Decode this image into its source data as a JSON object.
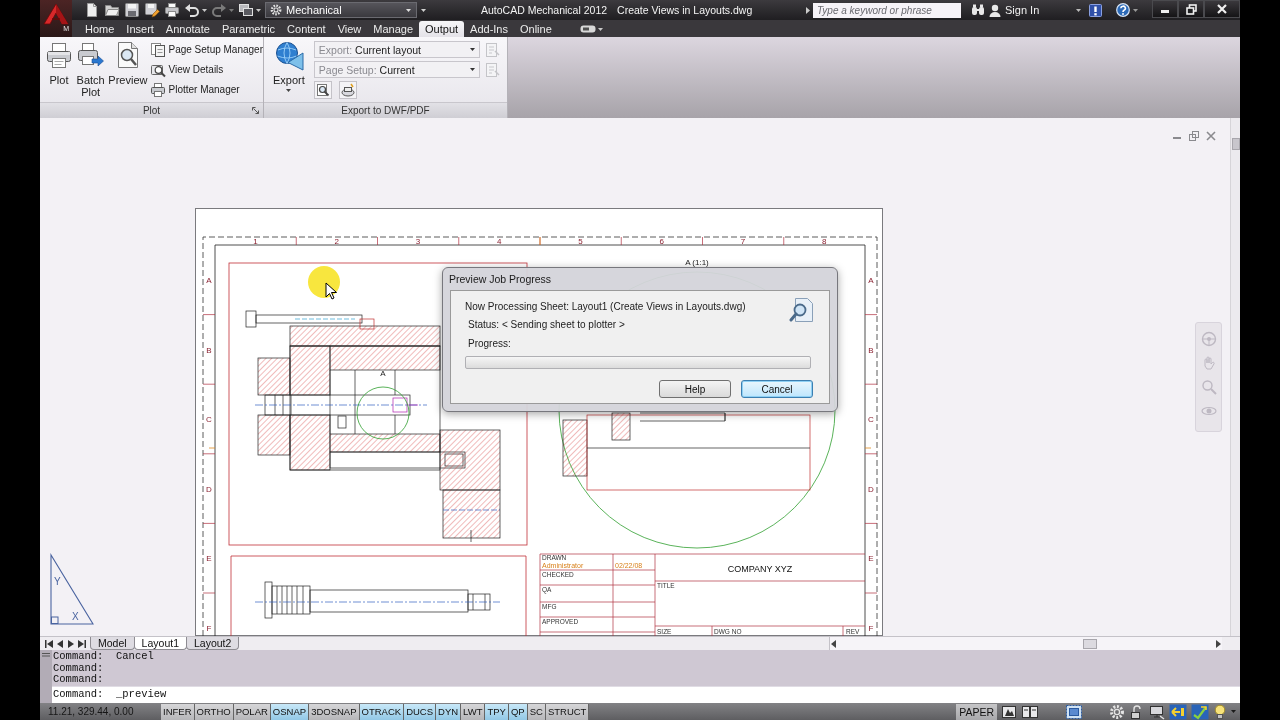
{
  "title_bar": {
    "product_badge": "M",
    "workspace": "Mechanical",
    "app_name": "AutoCAD Mechanical 2012",
    "document_name": "Create Views in Layouts.dwg",
    "search": {
      "placeholder": "Type a keyword or phrase"
    },
    "sign_in": "Sign In"
  },
  "ribbon_tabs": [
    {
      "label": "Home",
      "selected": false
    },
    {
      "label": "Insert",
      "selected": false
    },
    {
      "label": "Annotate",
      "selected": false
    },
    {
      "label": "Parametric",
      "selected": false
    },
    {
      "label": "Content",
      "selected": false
    },
    {
      "label": "View",
      "selected": false
    },
    {
      "label": "Manage",
      "selected": false
    },
    {
      "label": "Output",
      "selected": true
    },
    {
      "label": "Add-Ins",
      "selected": false
    },
    {
      "label": "Online",
      "selected": false
    }
  ],
  "plot_panel": {
    "title": "Plot",
    "large_buttons": [
      {
        "kind": "plot",
        "label": "Plot"
      },
      {
        "kind": "batch_plot",
        "label": "Batch Plot"
      },
      {
        "kind": "preview",
        "label": "Preview"
      }
    ],
    "small_buttons": [
      {
        "kind": "page_setup",
        "label": "Page Setup Manager"
      },
      {
        "kind": "view_details",
        "label": "View Details"
      },
      {
        "kind": "plotter_manager",
        "label": "Plotter Manager"
      }
    ]
  },
  "export_panel": {
    "title": "Export to DWF/PDF",
    "export_button": "Export",
    "dropdowns": [
      {
        "label": "Export:",
        "value": "Current layout"
      },
      {
        "label": "Page Setup:",
        "value": "Current"
      }
    ]
  },
  "drawing_sheet": {
    "zone_numbers": [
      "1",
      "2",
      "3",
      "4",
      "5",
      "6",
      "7",
      "8"
    ],
    "zone_letters_left": [
      "A",
      "B",
      "C",
      "D",
      "E",
      "F"
    ],
    "zone_letters_right": [
      "A",
      "B",
      "C",
      "D",
      "E",
      "F"
    ],
    "detail_view_label": "A (1:1)",
    "section_marker_label": "A",
    "title_block": {
      "drawn_label": "DRAWN",
      "drawn_by": "Administrator",
      "drawn_date": "02/22/08",
      "checked_label": "CHECKED",
      "qa_label": "QA",
      "mfg_label": "MFG",
      "approved_label": "APPROVED",
      "company": "COMPANY XYZ",
      "title_label": "TITLE",
      "size_label": "SIZE",
      "dwg_no_label": "DWG NO",
      "rev_label": "REV"
    }
  },
  "ucs_icon": {
    "y_label": "Y",
    "x_label": "X"
  },
  "preview_dialog": {
    "title": "Preview Job Progress",
    "sheet_line": "Now Processing Sheet: Layout1 (Create Views in Layouts.dwg)",
    "status_line": "Status: < Sending sheet to plotter >",
    "progress_label": "Progress:",
    "progress": {
      "level": 0
    },
    "buttons": [
      {
        "label": "Help",
        "focused": false
      },
      {
        "label": "Cancel",
        "focused": true
      }
    ]
  },
  "layout_tabs": [
    {
      "label": "Model",
      "selected": false
    },
    {
      "label": "Layout1",
      "selected": true
    },
    {
      "label": "Layout2",
      "selected": false
    }
  ],
  "command_window": {
    "history": [
      "Command:  Cancel",
      "Command:",
      "Command:"
    ],
    "prompt": "Command:  _preview"
  },
  "status_bar": {
    "coordinates": "11.21, 329.44, 0.00",
    "toggles": [
      {
        "label": "INFER",
        "on": false
      },
      {
        "label": "ORTHO",
        "on": false
      },
      {
        "label": "POLAR",
        "on": false
      },
      {
        "label": "OSNAP",
        "on": true
      },
      {
        "label": "3DOSNAP",
        "on": false
      },
      {
        "label": "OTRACK",
        "on": true
      },
      {
        "label": "DUCS",
        "on": true
      },
      {
        "label": "DYN",
        "on": true
      },
      {
        "label": "LWT",
        "on": false
      },
      {
        "label": "TPY",
        "on": true
      },
      {
        "label": "QP",
        "on": true
      },
      {
        "label": "SC",
        "on": false
      },
      {
        "label": "STRUCT",
        "on": false
      }
    ],
    "layout_mode": "PAPER"
  }
}
